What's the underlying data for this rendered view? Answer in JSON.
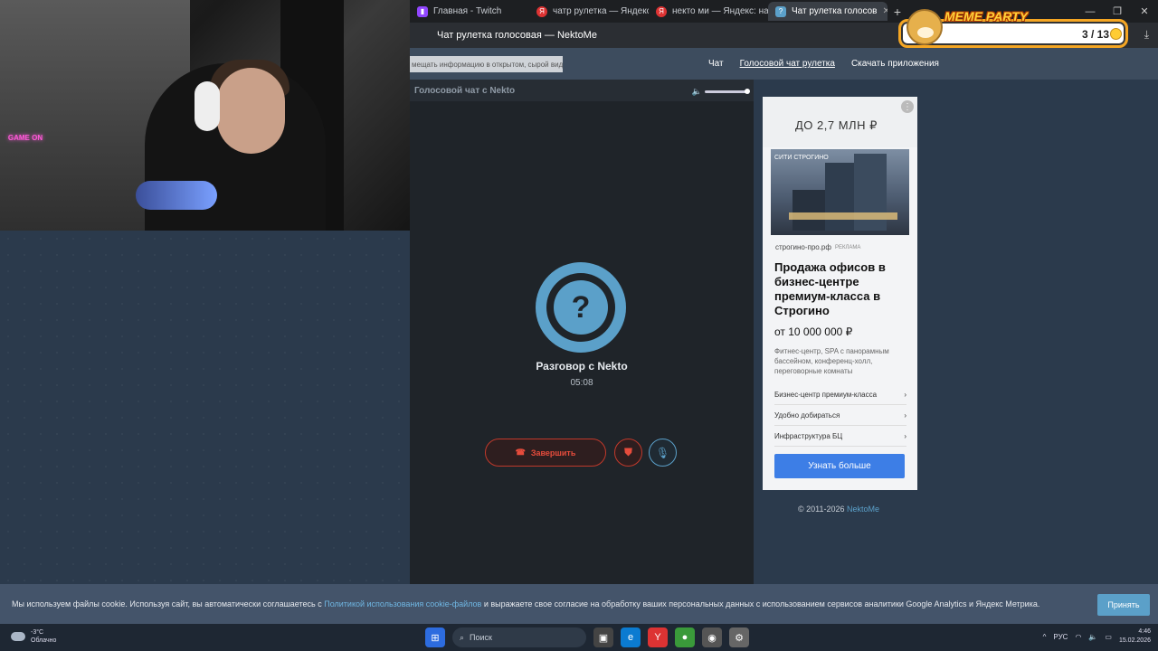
{
  "webcam": {
    "neon_sign": "GAME ON"
  },
  "browser": {
    "tabs": [
      {
        "label": "Главная - Twitch",
        "icon": "twitch-icon"
      },
      {
        "label": "чатр рулетка — Яндекс: н",
        "icon": "yandex-icon"
      },
      {
        "label": "некто ми — Яндекс: нашл",
        "icon": "yandex-icon"
      },
      {
        "label": "Чат рулетка голосов",
        "icon": "nekto-icon",
        "active": true
      }
    ],
    "page_title": "Чат рулетка голосовая — NektoMe"
  },
  "meme_overlay": {
    "title": "MEME PARTY",
    "count": "3 / 13"
  },
  "site_nav": {
    "warning": "мещать информацию в открытом, сырой виде!",
    "links": [
      "Чат",
      "Голосовой чат рулетка",
      "Скачать приложения"
    ]
  },
  "chat": {
    "header": "Голосовой чат с Nekto",
    "avatar_symbol": "?",
    "conversation_label": "Разговор с Nekto",
    "timer": "05:08",
    "end_label": "Завершить"
  },
  "ad": {
    "price_top": "ДО 2,7 МЛН ₽",
    "brand": "СИТИ СТРОГИНО",
    "domain": "строгино-про.рф",
    "tag": "РЕКЛАМА",
    "headline": "Продажа офисов в бизнес-центре премиум-класса в Строгино",
    "price": "от 10 000 000 ₽",
    "description": "Фитнес-центр, SPA с панорамным бассейном, конференц-холл, переговорные комнаты",
    "links": [
      "Бизнес-центр премиум-класса",
      "Удобно добираться",
      "Инфраструктура БЦ"
    ],
    "cta": "Узнать больше"
  },
  "footer": {
    "copyright": "© 2011-2026 ",
    "brand_link": "NektoMe"
  },
  "cookie": {
    "text_before": "Мы используем файлы cookie. Используя сайт, вы автоматически соглашаетесь с ",
    "link": "Политикой использования cookie-файлов",
    "text_after": " и выражаете свое согласие на обработку ваших персональных данных с использованием сервисов аналитики Google Analytics и Яндекс Метрика.",
    "accept": "Принять"
  },
  "taskbar": {
    "temperature": "-3°C",
    "weather": "Облачно",
    "search_placeholder": "Поиск",
    "language": "РУС",
    "time": "4:46",
    "date": "15.02.2026"
  }
}
